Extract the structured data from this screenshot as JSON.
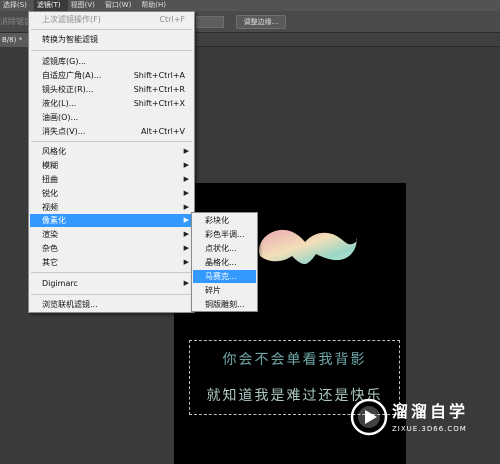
{
  "menubar": {
    "items": [
      {
        "label": "选择(S)"
      },
      {
        "label": "滤镜(T)"
      },
      {
        "label": "视图(V)"
      },
      {
        "label": "窗口(W)"
      },
      {
        "label": "帮助(H)"
      }
    ]
  },
  "options": {
    "feather_label": "消除锯齿",
    "refine_edge_label": "调整边缘..."
  },
  "tab": {
    "label": "B/8) *"
  },
  "filter_menu": {
    "last_filter": {
      "label": "上次滤镜操作(F)",
      "shortcut": "Ctrl+F"
    },
    "smart_filter": {
      "label": "转换为智能滤镜"
    },
    "filter_gallery": {
      "label": "滤镜库(G)..."
    },
    "adaptive_wide": {
      "label": "自适应广角(A)...",
      "shortcut": "Shift+Ctrl+A"
    },
    "lens_correction": {
      "label": "镜头校正(R)...",
      "shortcut": "Shift+Ctrl+R"
    },
    "liquify": {
      "label": "液化(L)...",
      "shortcut": "Shift+Ctrl+X"
    },
    "oil_paint": {
      "label": "油画(O)..."
    },
    "vanishing_point": {
      "label": "消失点(V)...",
      "shortcut": "Alt+Ctrl+V"
    },
    "stylize": {
      "label": "风格化"
    },
    "blur": {
      "label": "模糊"
    },
    "distort": {
      "label": "扭曲"
    },
    "sharpen": {
      "label": "锐化"
    },
    "video": {
      "label": "视频"
    },
    "pixelate": {
      "label": "像素化"
    },
    "render": {
      "label": "渲染"
    },
    "noise": {
      "label": "杂色"
    },
    "other": {
      "label": "其它"
    },
    "digimarc": {
      "label": "Digimarc"
    },
    "browse_online": {
      "label": "浏览联机滤镜..."
    }
  },
  "pixelate_submenu": {
    "crystallize_color": {
      "label": "彩块化"
    },
    "color_halftone": {
      "label": "彩色半调..."
    },
    "pointillize": {
      "label": "点状化..."
    },
    "crystallize": {
      "label": "晶格化..."
    },
    "mosaic": {
      "label": "马赛克..."
    },
    "fragment": {
      "label": "碎片"
    },
    "mezzotint": {
      "label": "铜版雕刻..."
    }
  },
  "canvas": {
    "text_line1": "你会不会单看我背影",
    "text_line2": "就知道我是难过还是快乐"
  },
  "watermark": {
    "name": "溜溜自学",
    "url": "ZIXUE.3D66.COM"
  },
  "colors": {
    "highlight": "#3399ff",
    "menu_bg": "#f0f0f0",
    "app_bg": "#3a3a3a"
  }
}
